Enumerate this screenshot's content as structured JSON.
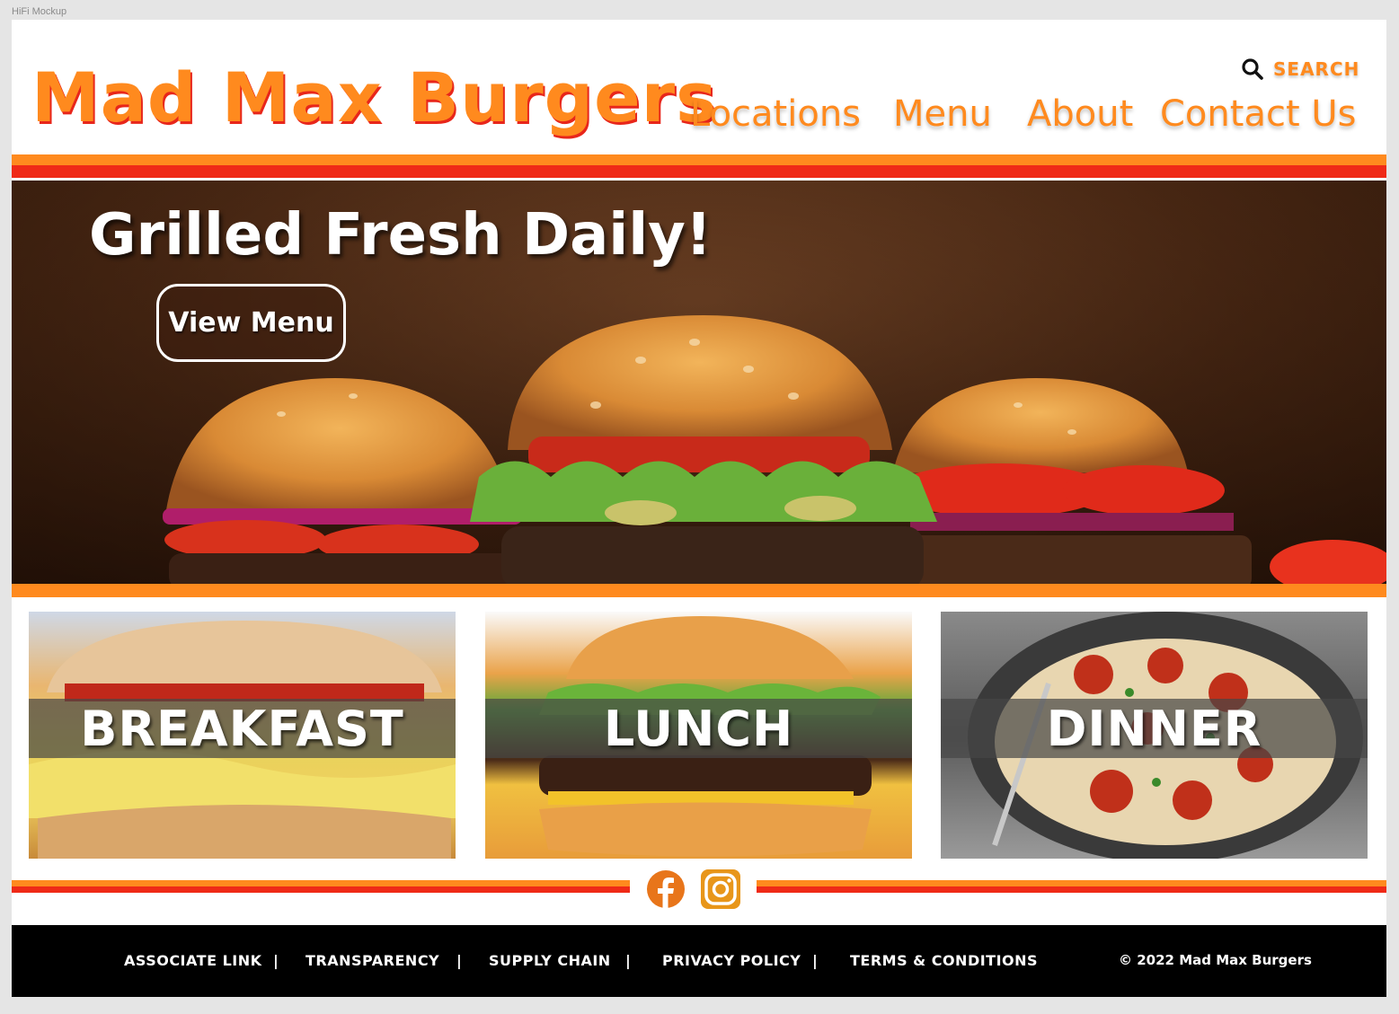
{
  "frame_label": "HiFi Mockup",
  "header": {
    "logo": "Mad Max Burgers",
    "search_label": "SEARCH",
    "nav": [
      "Locations",
      "Menu",
      "About",
      "Contact Us"
    ]
  },
  "hero": {
    "title": "Grilled Fresh Daily!",
    "button_label": "View Menu"
  },
  "categories": [
    "BREAKFAST",
    "LUNCH",
    "DINNER"
  ],
  "social": [
    "facebook-icon",
    "instagram-icon"
  ],
  "footer": {
    "links": [
      "ASSOCIATE LINK",
      "TRANSPARENCY",
      "SUPPLY CHAIN",
      "PRIVACY POLICY",
      "TERMS & CONDITIONS"
    ],
    "separator": "|",
    "copyright": "© 2022 Mad Max Burgers"
  },
  "colors": {
    "brand_orange": "#ff8a1e",
    "brand_red": "#ef2a17",
    "footer_bg": "#000000"
  }
}
